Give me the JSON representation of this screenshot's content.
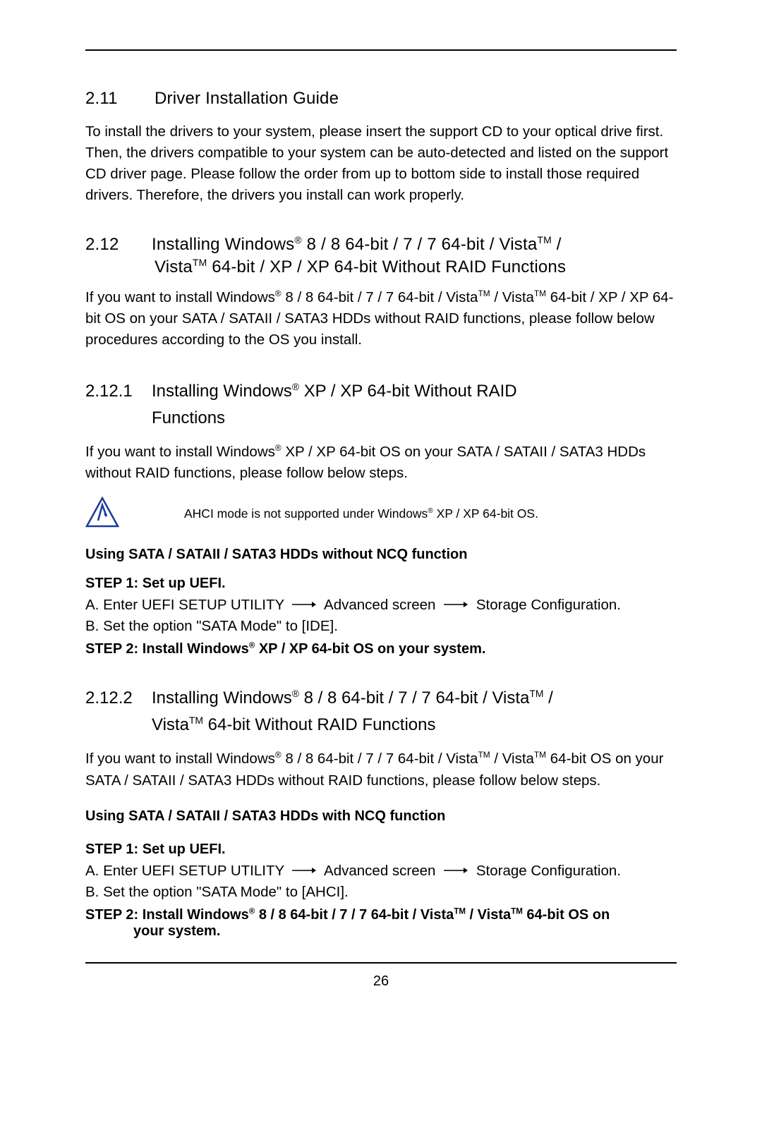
{
  "s211": {
    "num": "2.11",
    "title": "Driver Installation Guide",
    "body": "To install the drivers to your system, please insert the support CD to your optical drive first. Then, the drivers compatible to your system can be auto-detected and listed on the support CD driver page. Please follow the order from up to bottom side to install those required drivers. Therefore, the drivers you install can work properly."
  },
  "s212": {
    "num": "2.12",
    "title_pre": "Installing Windows",
    "title_mid": " 8 / 8 64-bit / 7 / 7 64-bit / Vista",
    "title_post": " /",
    "line2_pre": "Vista",
    "line2_post": " 64-bit / XP / XP 64-bit Without RAID Functions",
    "body_pre": "If you want to install Windows",
    "body_mid1": " 8 / 8 64-bit / 7 / 7 64-bit / Vista",
    "body_mid2": " / Vista",
    "body_post": " 64-bit / XP / XP 64-bit OS on your SATA / SATAII / SATA3 HDDs without RAID functions, please follow below procedures according to the OS you install."
  },
  "s2121": {
    "num": "2.12.1",
    "title_pre": "Installing Windows",
    "title_post": " XP / XP 64-bit Without RAID",
    "line2": "Functions",
    "body_pre": "If you want to install Windows",
    "body_post": " XP / XP 64-bit OS on your SATA / SATAII / SATA3 HDDs without RAID functions, please follow below steps.",
    "note_pre": "AHCI mode is not supported under Windows",
    "note_post": " XP / XP 64-bit OS.",
    "sub_heading": "Using SATA / SATAII / SATA3 HDDs without NCQ function",
    "step1_label": "STEP 1: Set up UEFI.",
    "step1_a_pre": "A. Enter UEFI SETUP UTILITY",
    "step1_a_mid": "Advanced screen",
    "step1_a_post": "Storage Configuration.",
    "step1_b": "B. Set the option \"SATA Mode\" to [IDE].",
    "step2_pre": "STEP 2: Install Windows",
    "step2_post": " XP / XP 64-bit OS on your system."
  },
  "s2122": {
    "num": "2.12.2",
    "title_pre": "Installing Windows",
    "title_mid": " 8 / 8 64-bit / 7 / 7 64-bit / Vista",
    "title_post": " /",
    "line2_pre": "Vista",
    "line2_post": " 64-bit Without RAID Functions",
    "body_pre": "If you want to install Windows",
    "body_mid1": " 8 / 8 64-bit / 7 / 7 64-bit / Vista",
    "body_mid2": " / Vista",
    "body_post": " 64-bit OS on your SATA / SATAII / SATA3 HDDs without RAID functions, please follow below steps.",
    "sub_heading": "Using SATA / SATAII / SATA3 HDDs with NCQ function",
    "step1_label": "STEP 1: Set up UEFI.",
    "step1_a_pre": "A. Enter UEFI SETUP UTILITY",
    "step1_a_mid": "Advanced screen",
    "step1_a_post": "Storage Configuration.",
    "step1_b": "B. Set the option \"SATA Mode\" to [AHCI].",
    "step2_pre": "STEP 2: Install Windows",
    "step2_mid1": " 8 / 8 64-bit / 7 / 7 64-bit / Vista",
    "step2_mid2": " / Vista",
    "step2_post": " 64-bit OS on",
    "step2_line2": "your system."
  },
  "page_number": "26"
}
